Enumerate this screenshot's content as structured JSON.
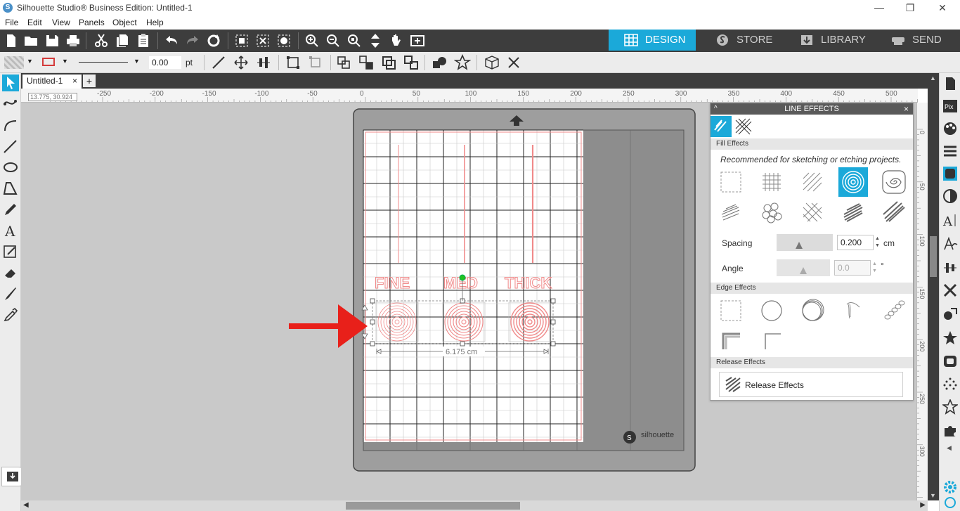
{
  "window": {
    "title": "Silhouette Studio® Business Edition: Untitled-1",
    "minimize": "—",
    "restore": "❐",
    "close": "✕"
  },
  "menu": [
    "File",
    "Edit",
    "View",
    "Panels",
    "Object",
    "Help"
  ],
  "nav_tabs": [
    {
      "label": "DESIGN",
      "icon": "grid-icon",
      "active": true
    },
    {
      "label": "STORE",
      "icon": "s-logo-icon",
      "active": false
    },
    {
      "label": "LIBRARY",
      "icon": "download-icon",
      "active": false
    },
    {
      "label": "SEND",
      "icon": "cutter-icon",
      "active": false
    }
  ],
  "line_toolbar": {
    "line_width": "0.00",
    "unit": "pt"
  },
  "document": {
    "tab_name": "Untitled-1",
    "tab_close": "×",
    "add_tab": "+",
    "cursor_coords": "13.775, 30.924"
  },
  "ruler": {
    "top_labels": [
      "-250",
      "-200",
      "-150",
      "-100",
      "-50",
      "0",
      "50",
      "100",
      "150",
      "200",
      "250",
      "300",
      "350",
      "400",
      "450",
      "500"
    ],
    "right_labels": [
      "0",
      "50",
      "100",
      "150",
      "200",
      "250",
      "300"
    ]
  },
  "canvas": {
    "labels": [
      "FINE",
      "MED",
      "THICK"
    ],
    "dimension": "6.175 cm",
    "mat_brand": "silhouette",
    "accent": "#e8201a"
  },
  "panel": {
    "title": "LINE EFFECTS",
    "collapse": "^",
    "close": "×",
    "fill_effects_heading": "Fill Effects",
    "fill_note": "Recommended for sketching or etching projects.",
    "spacing_label": "Spacing",
    "spacing_value": "0.200",
    "spacing_unit": "cm",
    "angle_label": "Angle",
    "angle_value": "0.0",
    "angle_unit": "°",
    "edge_effects_heading": "Edge Effects",
    "release_effects_heading": "Release Effects",
    "release_button": "Release Effects",
    "selected_fill": "spiral-circle"
  },
  "colors": {
    "accent": "#1ba9d9",
    "toolbar": "#3d3d3d",
    "mat": "#9e9e9e",
    "cut_lines": "#f08a8a"
  }
}
